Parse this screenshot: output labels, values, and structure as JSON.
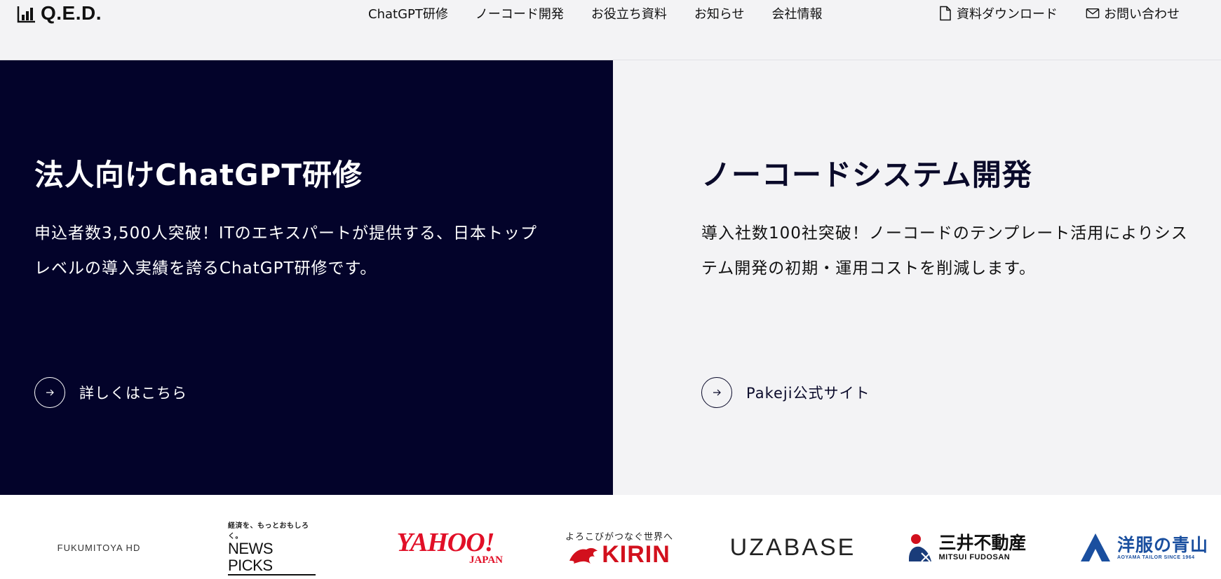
{
  "header": {
    "logo_text": "Q.E.D.",
    "nav": [
      {
        "label": "ChatGPT研修"
      },
      {
        "label": "ノーコード開発"
      },
      {
        "label": "お役立ち資料"
      },
      {
        "label": "お知らせ"
      },
      {
        "label": "会社情報"
      }
    ],
    "download_label": "資料ダウンロード",
    "contact_label": "お問い合わせ"
  },
  "panels": {
    "left": {
      "title": "法人向けChatGPT研修",
      "description": "申込者数3,500人突破！ITのエキスパートが提供する、日本トップレベルの導入実績を誇るChatGPT研修です。",
      "cta_label": "詳しくはこちら"
    },
    "right": {
      "title": "ノーコードシステム開発",
      "description": "導入社数100社突破！ノーコードのテンプレート活用によりシステム開発の初期・運用コストを削減します。",
      "cta_label": "Pakeji公式サイト"
    }
  },
  "clients": {
    "fukumitoya": "FUKUMITOYA HD",
    "newspicks_tagline": "経済を、もっとおもしろく。",
    "newspicks": "NEWS PICKS",
    "yahoo": "YAHOO!",
    "yahoo_sub": "JAPAN",
    "kirin_tagline": "よろこびがつなぐ世界へ",
    "kirin": "KIRIN",
    "uzabase": "UZABASE",
    "mitsui": "三井不動産",
    "mitsui_sub": "MITSUI FUDOSAN",
    "aoyama": "洋服の青山",
    "aoyama_sub": "AOYAMA TAILOR SINCE 1964"
  },
  "colors": {
    "dark_panel": "#03032a",
    "light_panel": "#f3f3f5",
    "yahoo_red": "#e10f27",
    "kirin_red": "#d2101d",
    "aoyama_blue": "#1a4f9f"
  }
}
